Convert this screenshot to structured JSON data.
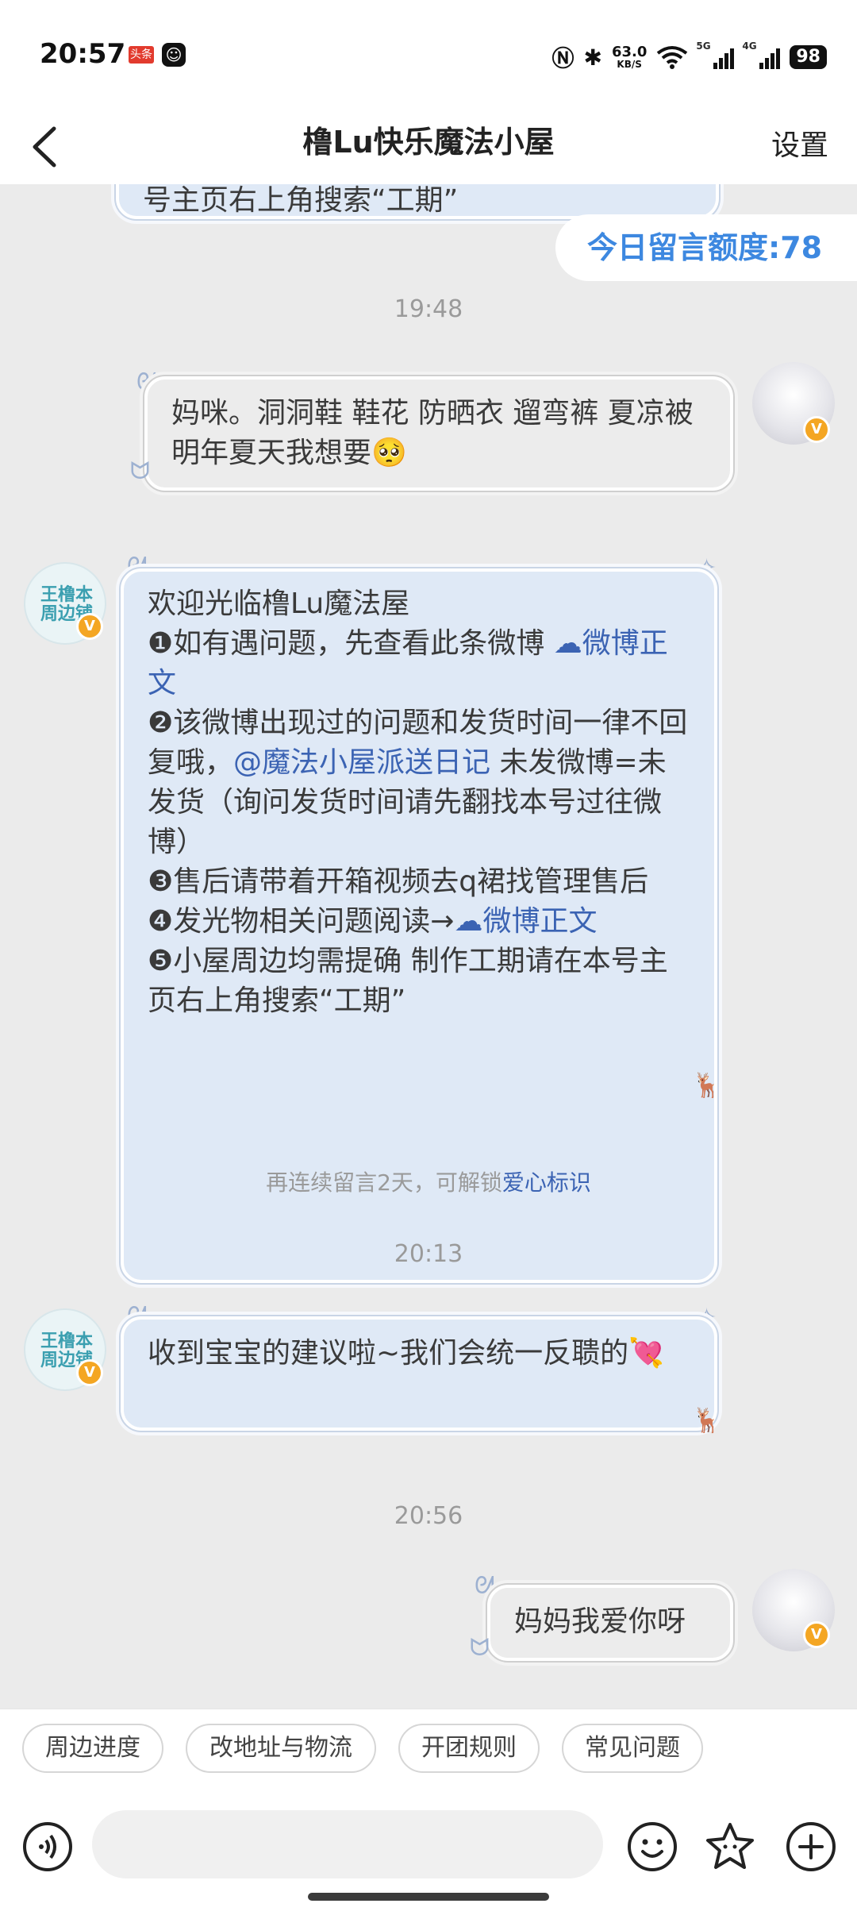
{
  "status_bar": {
    "time": "20:57",
    "news_badge": "头条",
    "net_speed": "63.0",
    "net_unit": "KB/S",
    "signal_1": "5G",
    "signal_2": "4G",
    "battery": "98"
  },
  "header": {
    "title": "橹Lu快乐魔法小屋",
    "settings_label": "设置"
  },
  "quota": "今日留言额度:78",
  "messages": [
    {
      "type": "partial",
      "text": "号主页右上角搜索“工期”"
    },
    {
      "type": "time",
      "text": "19:48"
    },
    {
      "type": "sent",
      "text": "妈咪。洞洞鞋 鞋花 防晒衣 遛弯裤 夏凉被明年夏天我想要🥺"
    },
    {
      "type": "received",
      "line1": "欢迎光临橹Lu魔法屋",
      "p1_text": "❶如有遇问题，先查看此条微博 ",
      "p1_link": "微博正文",
      "p2_text": "❷该微博出现过的问题和发货时间一律不回复哦，",
      "p2_link": "@魔法小屋派送日记",
      "p2_rest": " 未发微博=未发货（询问发货时间请先翻找本号过往微博）",
      "p3": "❸售后请带着开箱视频去q裙找管理售后",
      "p4_text": "❹发光物相关问题阅读→",
      "p4_link": "微博正文",
      "p5": "❺小屋周边均需提确 制作工期请在本号主页右上角搜索“工期”"
    },
    {
      "type": "notice",
      "text": "再连续留言2天，可解锁",
      "link": "爱心标识"
    },
    {
      "type": "time",
      "text": "20:13"
    },
    {
      "type": "received_short",
      "text": "收到宝宝的建议啦~我们会统一反聩的💘"
    },
    {
      "type": "time",
      "text": "20:56"
    },
    {
      "type": "sent_short",
      "text": "妈妈我爱你呀"
    }
  ],
  "avatars": {
    "shop_text": "王橹本周边铺",
    "verified_badge": "V"
  },
  "quick_actions": [
    "周边进度",
    "改地址与物流",
    "开团规则",
    "常见问题"
  ],
  "input": {
    "placeholder": ""
  },
  "colors": {
    "accent": "#3d88e0",
    "link": "#3b63b3",
    "bubble_bg": "#dfe9f6",
    "badge": "#f4a623"
  }
}
